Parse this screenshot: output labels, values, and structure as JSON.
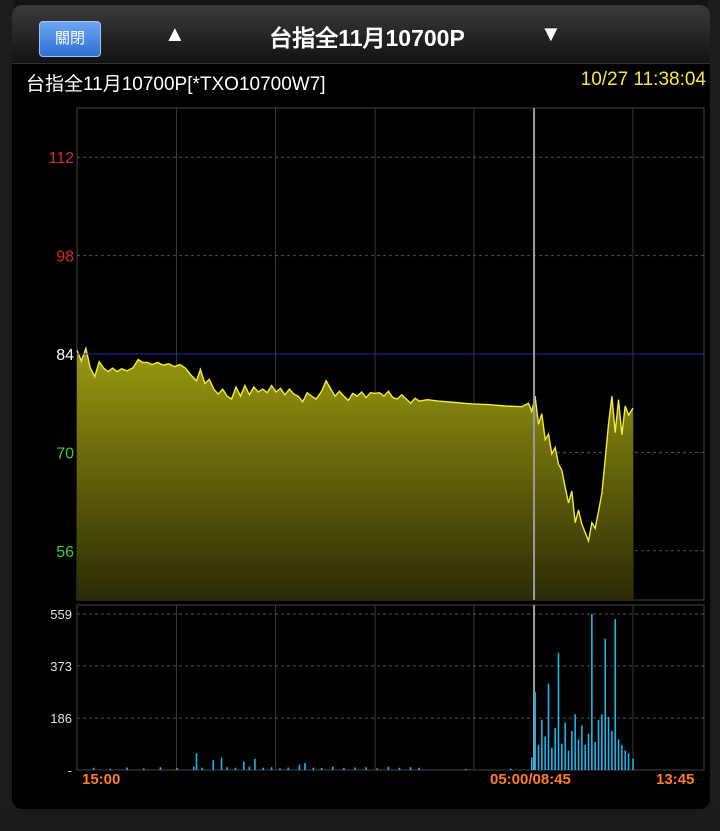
{
  "dialog": {
    "close_label": "關閉",
    "prev_icon": "up-triangle-icon",
    "next_icon": "down-triangle-icon",
    "title": "台指全11月10700P",
    "info": "台指全11月10700P[*TXO10700W7]",
    "time": "10/27 11:38:04"
  },
  "chart_data": {
    "type": "area",
    "reference_price": 84,
    "price_axis": {
      "ticks": [
        {
          "value": 112,
          "label": "112",
          "color": "#d42a2a"
        },
        {
          "value": 98,
          "label": "98",
          "color": "#d42a2a"
        },
        {
          "value": 84,
          "label": "84",
          "color": "#ffffff"
        },
        {
          "value": 70,
          "label": "70",
          "color": "#3ec83e"
        },
        {
          "value": 56,
          "label": "56",
          "color": "#3ec83e"
        }
      ],
      "ylim": [
        49,
        119
      ]
    },
    "volume_axis": {
      "ticks": [
        {
          "value": 559,
          "label": "559"
        },
        {
          "value": 373,
          "label": "373"
        },
        {
          "value": 186,
          "label": "186"
        },
        {
          "value": 0,
          "label": "-"
        }
      ],
      "ylim": [
        0,
        559
      ]
    },
    "x_labels": [
      "15:00",
      "05:00/08:45",
      "13:45"
    ],
    "session_divider": 0.822,
    "price": [
      [
        0.0,
        84.5
      ],
      [
        0.008,
        83.0
      ],
      [
        0.016,
        84.8
      ],
      [
        0.024,
        82.0
      ],
      [
        0.032,
        80.8
      ],
      [
        0.04,
        82.9
      ],
      [
        0.048,
        82.0
      ],
      [
        0.056,
        81.5
      ],
      [
        0.064,
        82.0
      ],
      [
        0.072,
        81.5
      ],
      [
        0.08,
        81.9
      ],
      [
        0.09,
        81.6
      ],
      [
        0.1,
        82.0
      ],
      [
        0.11,
        83.2
      ],
      [
        0.118,
        82.8
      ],
      [
        0.126,
        82.8
      ],
      [
        0.135,
        82.5
      ],
      [
        0.145,
        82.8
      ],
      [
        0.155,
        82.4
      ],
      [
        0.165,
        82.6
      ],
      [
        0.175,
        82.2
      ],
      [
        0.185,
        82.5
      ],
      [
        0.195,
        82.0
      ],
      [
        0.205,
        81.0
      ],
      [
        0.215,
        80.2
      ],
      [
        0.222,
        81.8
      ],
      [
        0.23,
        79.8
      ],
      [
        0.238,
        80.4
      ],
      [
        0.246,
        79.0
      ],
      [
        0.254,
        78.3
      ],
      [
        0.262,
        79.0
      ],
      [
        0.27,
        78.0
      ],
      [
        0.278,
        77.6
      ],
      [
        0.286,
        79.3
      ],
      [
        0.294,
        78.0
      ],
      [
        0.302,
        79.5
      ],
      [
        0.31,
        78.2
      ],
      [
        0.318,
        79.3
      ],
      [
        0.326,
        78.6
      ],
      [
        0.334,
        79.0
      ],
      [
        0.342,
        78.5
      ],
      [
        0.35,
        79.5
      ],
      [
        0.358,
        78.6
      ],
      [
        0.366,
        79.1
      ],
      [
        0.374,
        78.2
      ],
      [
        0.382,
        79.0
      ],
      [
        0.39,
        78.3
      ],
      [
        0.398,
        78.0
      ],
      [
        0.406,
        77.2
      ],
      [
        0.414,
        78.5
      ],
      [
        0.422,
        78.0
      ],
      [
        0.43,
        77.6
      ],
      [
        0.44,
        78.7
      ],
      [
        0.448,
        80.2
      ],
      [
        0.456,
        79.1
      ],
      [
        0.464,
        78.0
      ],
      [
        0.472,
        78.7
      ],
      [
        0.48,
        78.0
      ],
      [
        0.488,
        77.4
      ],
      [
        0.496,
        78.4
      ],
      [
        0.504,
        78.0
      ],
      [
        0.512,
        78.6
      ],
      [
        0.52,
        77.8
      ],
      [
        0.528,
        78.5
      ],
      [
        0.536,
        78.4
      ],
      [
        0.544,
        78.5
      ],
      [
        0.552,
        78.0
      ],
      [
        0.56,
        78.7
      ],
      [
        0.568,
        77.8
      ],
      [
        0.576,
        77.6
      ],
      [
        0.584,
        78.2
      ],
      [
        0.592,
        77.6
      ],
      [
        0.6,
        77.0
      ],
      [
        0.608,
        77.7
      ],
      [
        0.616,
        77.3
      ],
      [
        0.63,
        77.5
      ],
      [
        0.65,
        77.3
      ],
      [
        0.68,
        77.1
      ],
      [
        0.71,
        76.9
      ],
      [
        0.74,
        76.8
      ],
      [
        0.77,
        76.6
      ],
      [
        0.8,
        76.5
      ],
      [
        0.812,
        77.0
      ],
      [
        0.818,
        75.8
      ],
      [
        0.824,
        78.0
      ],
      [
        0.83,
        74.0
      ],
      [
        0.836,
        75.5
      ],
      [
        0.842,
        71.8
      ],
      [
        0.848,
        72.6
      ],
      [
        0.854,
        69.8
      ],
      [
        0.86,
        70.7
      ],
      [
        0.866,
        68.3
      ],
      [
        0.872,
        67.5
      ],
      [
        0.878,
        65.0
      ],
      [
        0.884,
        62.8
      ],
      [
        0.89,
        64.5
      ],
      [
        0.896,
        60.0
      ],
      [
        0.902,
        61.8
      ],
      [
        0.908,
        59.8
      ],
      [
        0.914,
        58.6
      ],
      [
        0.92,
        57.4
      ],
      [
        0.926,
        60.0
      ],
      [
        0.932,
        59.2
      ],
      [
        0.938,
        61.6
      ],
      [
        0.944,
        64.2
      ],
      [
        0.95,
        69.0
      ],
      [
        0.956,
        74.0
      ],
      [
        0.962,
        78.0
      ],
      [
        0.968,
        72.8
      ],
      [
        0.974,
        77.5
      ],
      [
        0.98,
        72.5
      ],
      [
        0.986,
        76.6
      ],
      [
        0.992,
        75.3
      ],
      [
        1.0,
        76.3
      ]
    ],
    "volume": [
      [
        0.03,
        8
      ],
      [
        0.06,
        5
      ],
      [
        0.09,
        9
      ],
      [
        0.12,
        6
      ],
      [
        0.15,
        10
      ],
      [
        0.18,
        7
      ],
      [
        0.21,
        12
      ],
      [
        0.215,
        60
      ],
      [
        0.225,
        8
      ],
      [
        0.245,
        35
      ],
      [
        0.26,
        45
      ],
      [
        0.27,
        10
      ],
      [
        0.285,
        8
      ],
      [
        0.3,
        30
      ],
      [
        0.31,
        12
      ],
      [
        0.32,
        40
      ],
      [
        0.335,
        8
      ],
      [
        0.35,
        10
      ],
      [
        0.365,
        6
      ],
      [
        0.38,
        9
      ],
      [
        0.4,
        18
      ],
      [
        0.41,
        25
      ],
      [
        0.425,
        8
      ],
      [
        0.44,
        7
      ],
      [
        0.46,
        12
      ],
      [
        0.48,
        8
      ],
      [
        0.5,
        9
      ],
      [
        0.52,
        10
      ],
      [
        0.54,
        6
      ],
      [
        0.56,
        12
      ],
      [
        0.58,
        8
      ],
      [
        0.6,
        10
      ],
      [
        0.615,
        8
      ],
      [
        0.7,
        4
      ],
      [
        0.78,
        5
      ],
      [
        0.818,
        45
      ],
      [
        0.824,
        280
      ],
      [
        0.83,
        90
      ],
      [
        0.836,
        180
      ],
      [
        0.842,
        120
      ],
      [
        0.848,
        310
      ],
      [
        0.854,
        80
      ],
      [
        0.86,
        150
      ],
      [
        0.866,
        420
      ],
      [
        0.872,
        95
      ],
      [
        0.878,
        170
      ],
      [
        0.884,
        70
      ],
      [
        0.89,
        140
      ],
      [
        0.896,
        200
      ],
      [
        0.902,
        110
      ],
      [
        0.908,
        160
      ],
      [
        0.914,
        90
      ],
      [
        0.92,
        130
      ],
      [
        0.926,
        559
      ],
      [
        0.932,
        100
      ],
      [
        0.938,
        180
      ],
      [
        0.944,
        200
      ],
      [
        0.95,
        470
      ],
      [
        0.956,
        190
      ],
      [
        0.962,
        140
      ],
      [
        0.968,
        540
      ],
      [
        0.974,
        110
      ],
      [
        0.98,
        90
      ],
      [
        0.986,
        70
      ],
      [
        0.992,
        60
      ],
      [
        1.0,
        40
      ]
    ]
  }
}
